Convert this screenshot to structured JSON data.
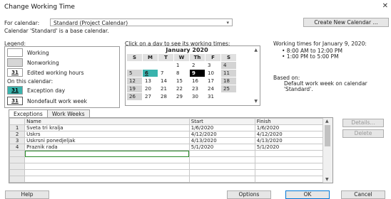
{
  "window": {
    "title": "Change Working Time",
    "close_glyph": "✕"
  },
  "for_calendar": {
    "label": "For calendar:",
    "value": "Standard (Project Calendar)"
  },
  "create_button": "Create New Calendar ...",
  "base_text": "Calendar 'Standard' is a base calendar.",
  "legend": {
    "title": "Legend:",
    "items": [
      {
        "label": "Working",
        "swatch": ""
      },
      {
        "label": "Nonworking",
        "swatch": ""
      },
      {
        "label": "Edited working hours",
        "swatch": "31"
      }
    ],
    "on_this_calendar": "On this calendar:",
    "cal_items": [
      {
        "label": "Exception day",
        "swatch": "31"
      },
      {
        "label": "Nondefault work week",
        "swatch": "31"
      }
    ],
    "colors": {
      "exception": "#39b3ad",
      "nonworking": "#d4d4d4",
      "selected": "#000000"
    }
  },
  "calendar": {
    "instruction": "Click on a day to see its working times:",
    "month": "January 2020",
    "days": [
      "S",
      "M",
      "T",
      "W",
      "Th",
      "F",
      "S"
    ],
    "weeks": [
      [
        "",
        "",
        "",
        "1",
        "2",
        "3",
        "4"
      ],
      [
        "5",
        "6",
        "7",
        "8",
        "9",
        "10",
        "11"
      ],
      [
        "12",
        "13",
        "14",
        "15",
        "16",
        "17",
        "18"
      ],
      [
        "19",
        "20",
        "21",
        "22",
        "23",
        "24",
        "25"
      ],
      [
        "26",
        "27",
        "28",
        "29",
        "30",
        "31",
        ""
      ]
    ]
  },
  "working_times": {
    "title": "Working times for January 9, 2020:",
    "times": [
      "• 8:00 AM to 12:00 PM",
      "• 1:00 PM to 5:00 PM"
    ],
    "based_on": "Based on:",
    "based_text": [
      "Default work week on calendar",
      "'Standard'."
    ]
  },
  "tabs": [
    "Exceptions",
    "Work Weeks"
  ],
  "exceptions": {
    "headers": [
      "",
      "Name",
      "Start",
      "Finish"
    ],
    "rows": [
      {
        "num": "1",
        "name": "Sveta tri kralja",
        "start": "1/6/2020",
        "finish": "1/6/2020"
      },
      {
        "num": "2",
        "name": "Uskrs",
        "start": "4/12/2020",
        "finish": "4/12/2020"
      },
      {
        "num": "3",
        "name": "Uskrsni ponedjeljak",
        "start": "4/13/2020",
        "finish": "4/13/2020"
      },
      {
        "num": "4",
        "name": "Praznik rada",
        "start": "5/1/2020",
        "finish": "5/1/2020"
      }
    ]
  },
  "side_buttons": {
    "details": "Details...",
    "delete": "Delete"
  },
  "bottom_buttons": {
    "help": "Help",
    "options": "Options",
    "ok": "OK",
    "cancel": "Cancel"
  }
}
